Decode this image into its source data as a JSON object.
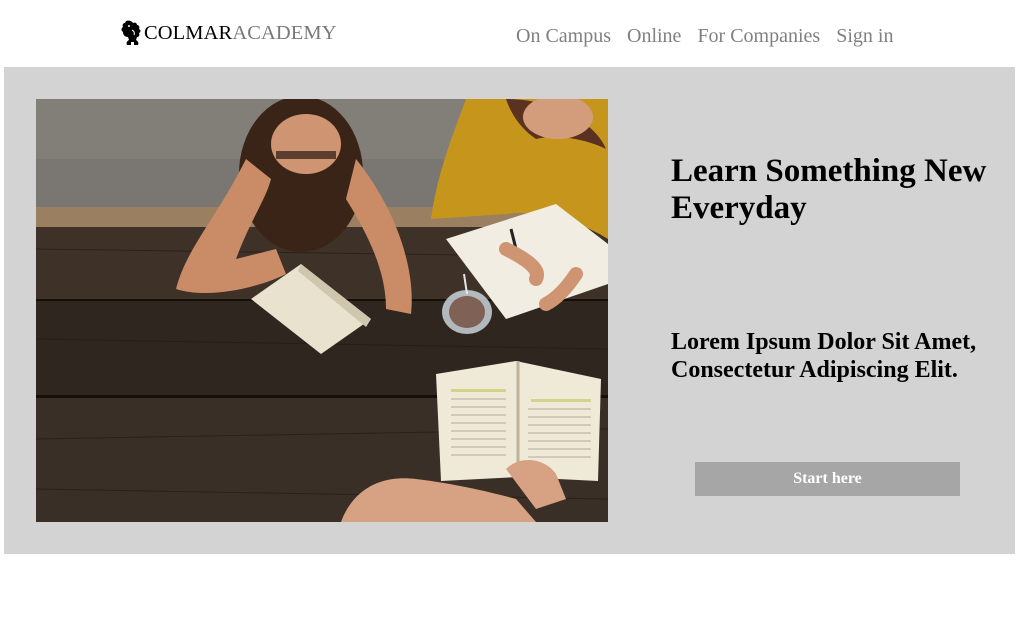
{
  "header": {
    "logo": {
      "part1": "COLMAR",
      "part2": "ACADEMY",
      "icon": "lion-rampant-icon"
    },
    "nav": [
      {
        "label": "On Campus"
      },
      {
        "label": "Online"
      },
      {
        "label": "For Companies"
      },
      {
        "label": "Sign in"
      }
    ]
  },
  "hero": {
    "image": "students-reading-at-picnic-table",
    "title": "Learn Something New Everyday",
    "subtitle": "Lorem Ipsum Dolor Sit Amet, Consectetur Adipiscing Elit.",
    "cta_label": "Start here"
  },
  "colors": {
    "hero_background": "#d3d3d3",
    "nav_text": "#808080",
    "logo_academy": "#7a7a7a",
    "button_background": "#a6a6a6",
    "button_text": "#ffffff"
  }
}
